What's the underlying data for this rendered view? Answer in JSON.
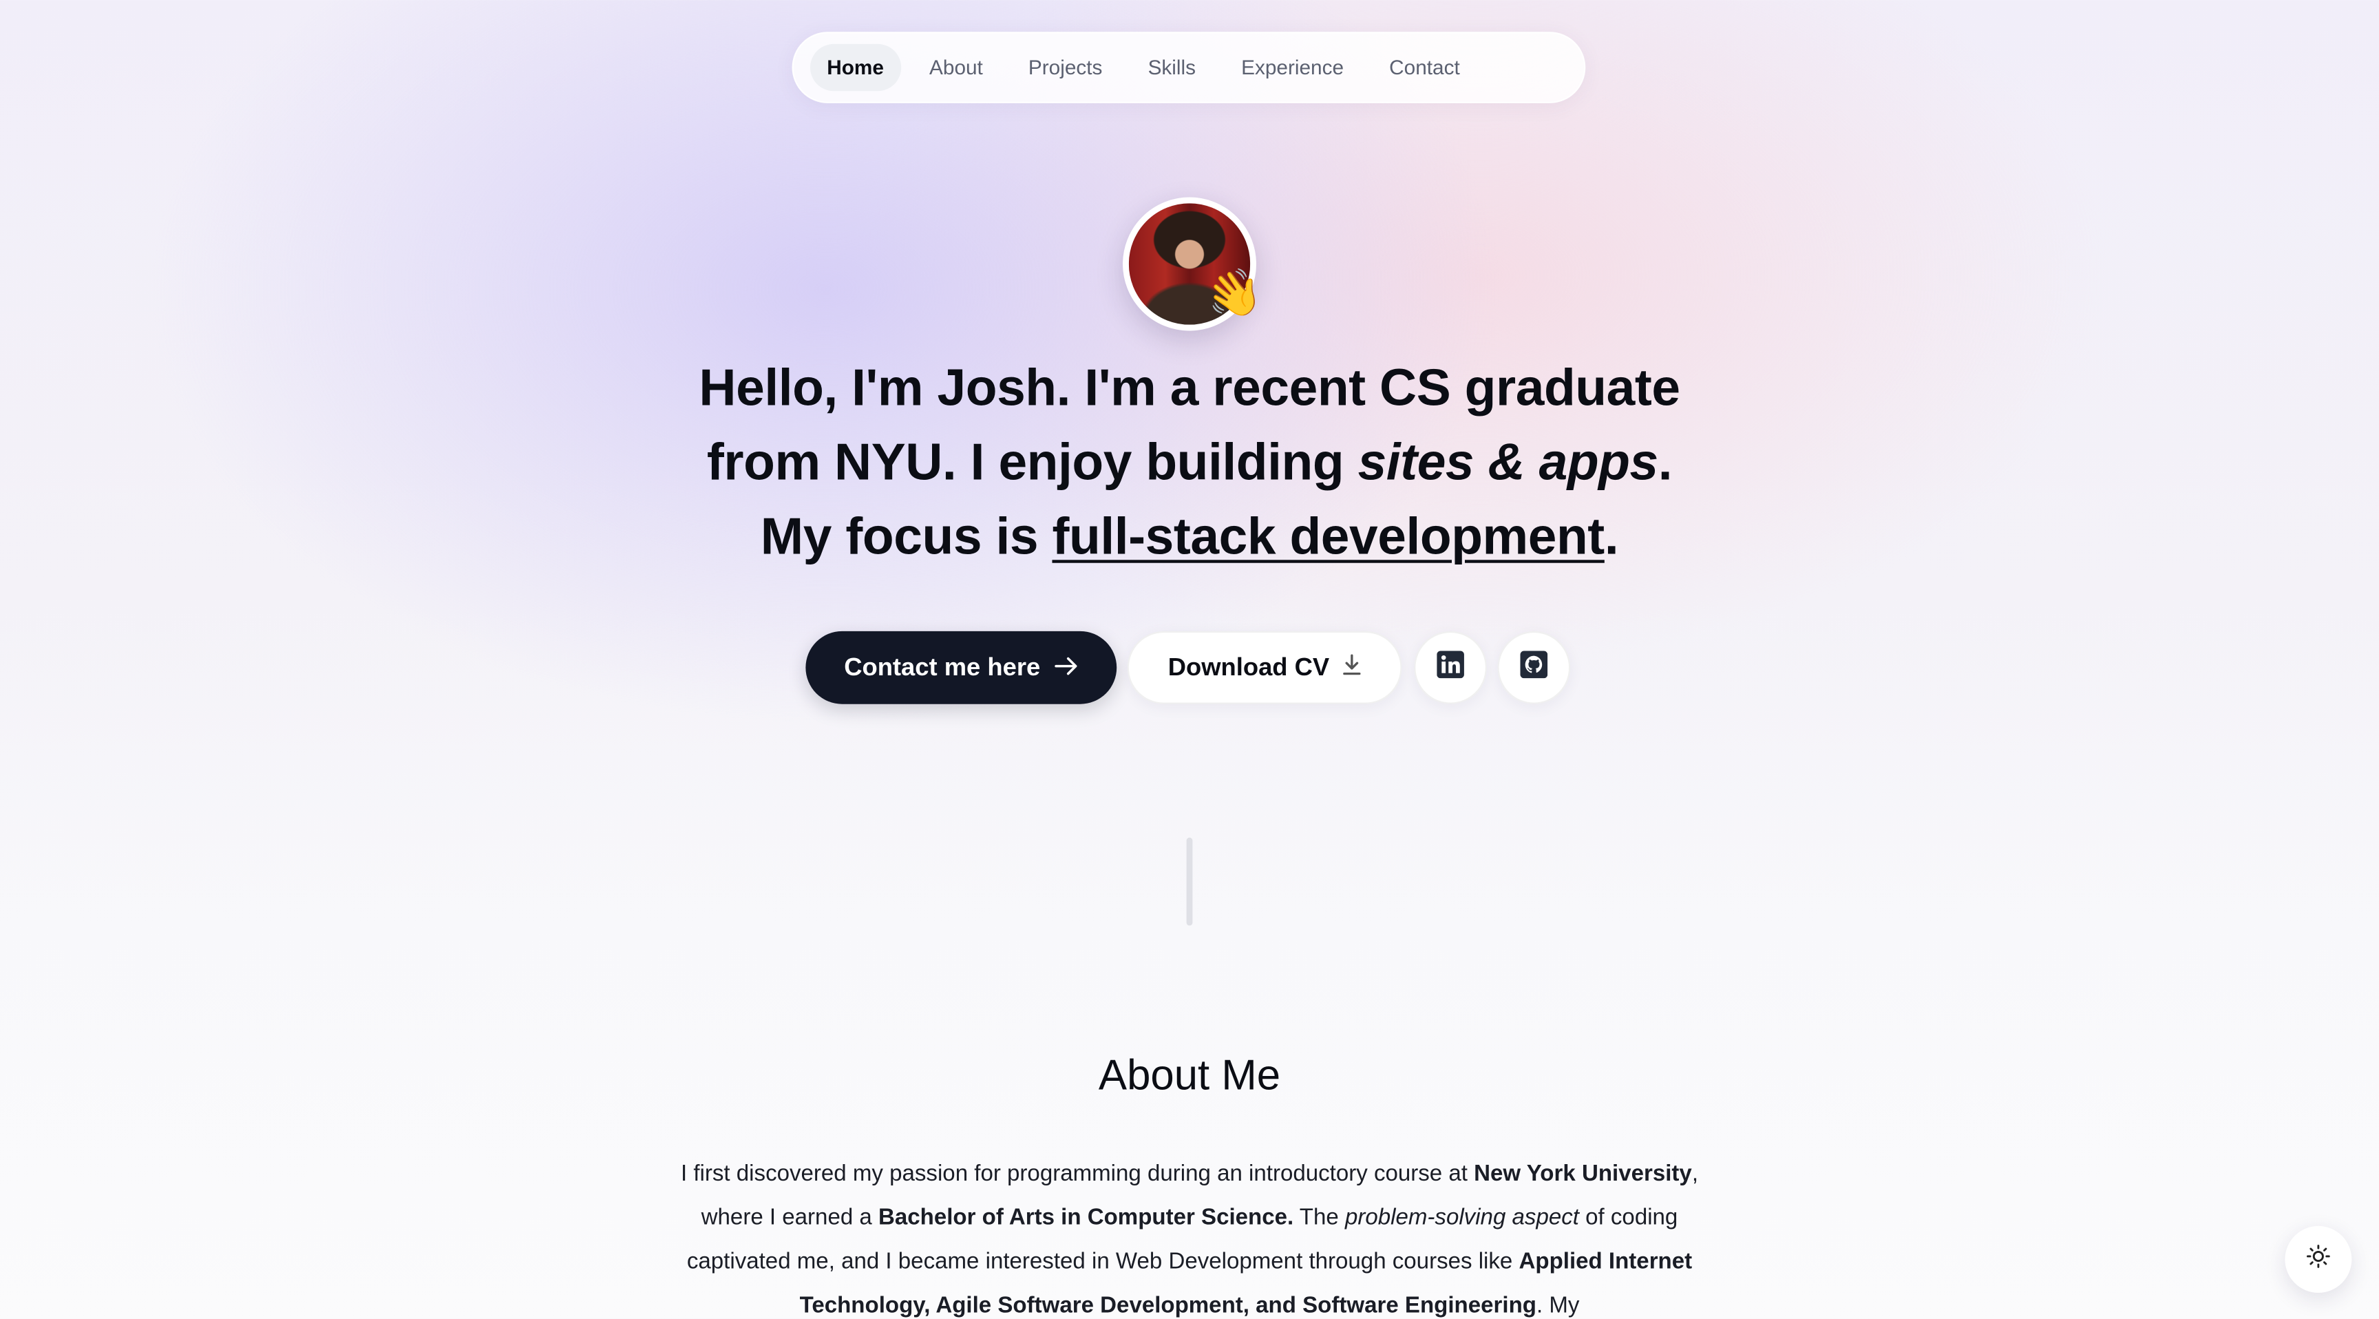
{
  "nav": {
    "items": [
      "Home",
      "About",
      "Projects",
      "Skills",
      "Experience",
      "Contact"
    ],
    "active": "Home"
  },
  "hero": {
    "avatar_alt": "Josh",
    "wave_emoji": "👋",
    "headline": {
      "greeting": "Hello, I'm Josh.",
      "p1": " I'm a ",
      "role": "recent CS graduate from NYU.",
      "p2": " I enjoy building ",
      "building": "sites & apps",
      "p3": ". My focus is ",
      "focus": "full-stack development",
      "p4": "."
    },
    "contact_button": "Contact me here",
    "cv_button": "Download CV"
  },
  "about": {
    "title": "About Me",
    "t1": "I first discovered my passion for programming during an introductory course at ",
    "school": "New York University",
    "t2": ", where I earned a ",
    "degree": "Bachelor of Arts in Computer Science.",
    "t3": " The ",
    "aspect": "problem-solving aspect",
    "t4": " of coding captivated me, and I became interested in Web Development through courses like ",
    "courses": "Applied Internet Technology, Agile Software Development, and Software Engineering",
    "t5": ". My"
  },
  "icons": {
    "contact_arrow": "arrow-right-icon",
    "cv": "download-icon",
    "linkedin": "linkedin-icon",
    "github": "github-icon",
    "theme": "sun-icon"
  },
  "colors": {
    "primary_button": "#121726",
    "text": "#0b0d14",
    "accent_purple": "#cdc4f6",
    "accent_pink": "#f6d4de"
  }
}
